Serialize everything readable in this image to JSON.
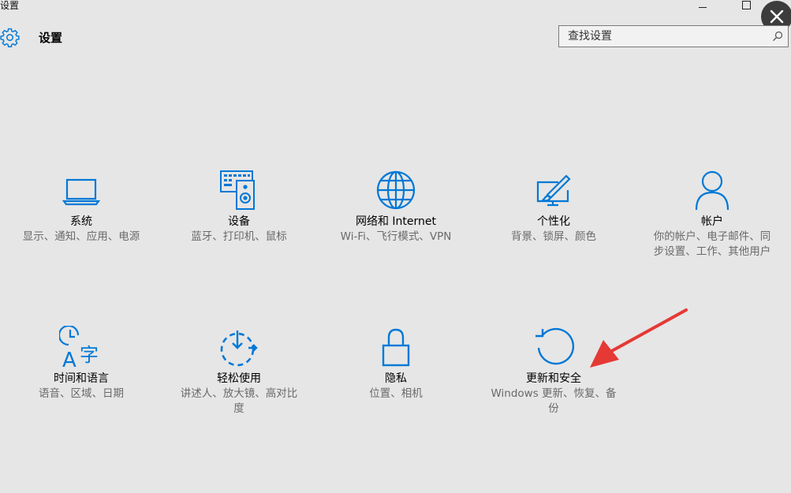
{
  "window": {
    "title": "设置",
    "buttons": {
      "minimize_icon": "minimize-icon",
      "maximize_icon": "maximize-icon",
      "close_icon": "close-x-icon"
    }
  },
  "header": {
    "icon": "gear-icon",
    "title": "设置"
  },
  "search": {
    "placeholder": "查找设置",
    "value": "",
    "icon": "search-icon"
  },
  "tiles": [
    {
      "icon": "laptop-icon",
      "label": "系统",
      "desc": "显示、通知、应用、电源"
    },
    {
      "icon": "keyboard-speaker-icon",
      "label": "设备",
      "desc": "蓝牙、打印机、鼠标"
    },
    {
      "icon": "globe-icon",
      "label": "网络和 Internet",
      "desc": "Wi-Fi、飞行模式、VPN"
    },
    {
      "icon": "paint-brush-screen-icon",
      "label": "个性化",
      "desc": "背景、锁屏、颜色"
    },
    {
      "icon": "person-icon",
      "label": "帐户",
      "desc": "你的帐户、电子邮件、同步设置、工作、其他用户"
    },
    {
      "icon": "time-language-icon",
      "label": "时间和语言",
      "desc": "语音、区域、日期"
    },
    {
      "icon": "ease-of-access-timer-icon",
      "label": "轻松使用",
      "desc": "讲述人、放大镜、高对比度"
    },
    {
      "icon": "lock-icon",
      "label": "隐私",
      "desc": "位置、相机"
    },
    {
      "icon": "refresh-arrow-icon",
      "label": "更新和安全",
      "desc": "Windows 更新、恢复、备份"
    }
  ],
  "colors": {
    "accent": "#0078d7",
    "background": "#e6e6e6",
    "annotation_arrow": "#e53935"
  }
}
